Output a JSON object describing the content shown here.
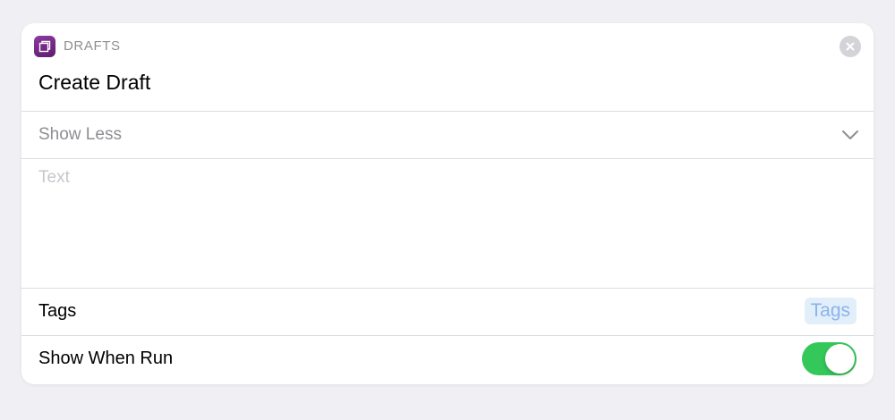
{
  "header": {
    "app_name": "DRAFTS",
    "action_title": "Create Draft",
    "app_icon": "drafts-app-icon",
    "close_icon": "close-icon",
    "brand_color": "#7a2a8c"
  },
  "disclosure": {
    "label": "Show Less",
    "icon": "chevron-down-icon"
  },
  "text_param": {
    "placeholder": "Text",
    "value": ""
  },
  "tags_param": {
    "label": "Tags",
    "token": "Tags"
  },
  "show_when_run": {
    "label": "Show When Run",
    "enabled": true,
    "on_color": "#34c759"
  }
}
